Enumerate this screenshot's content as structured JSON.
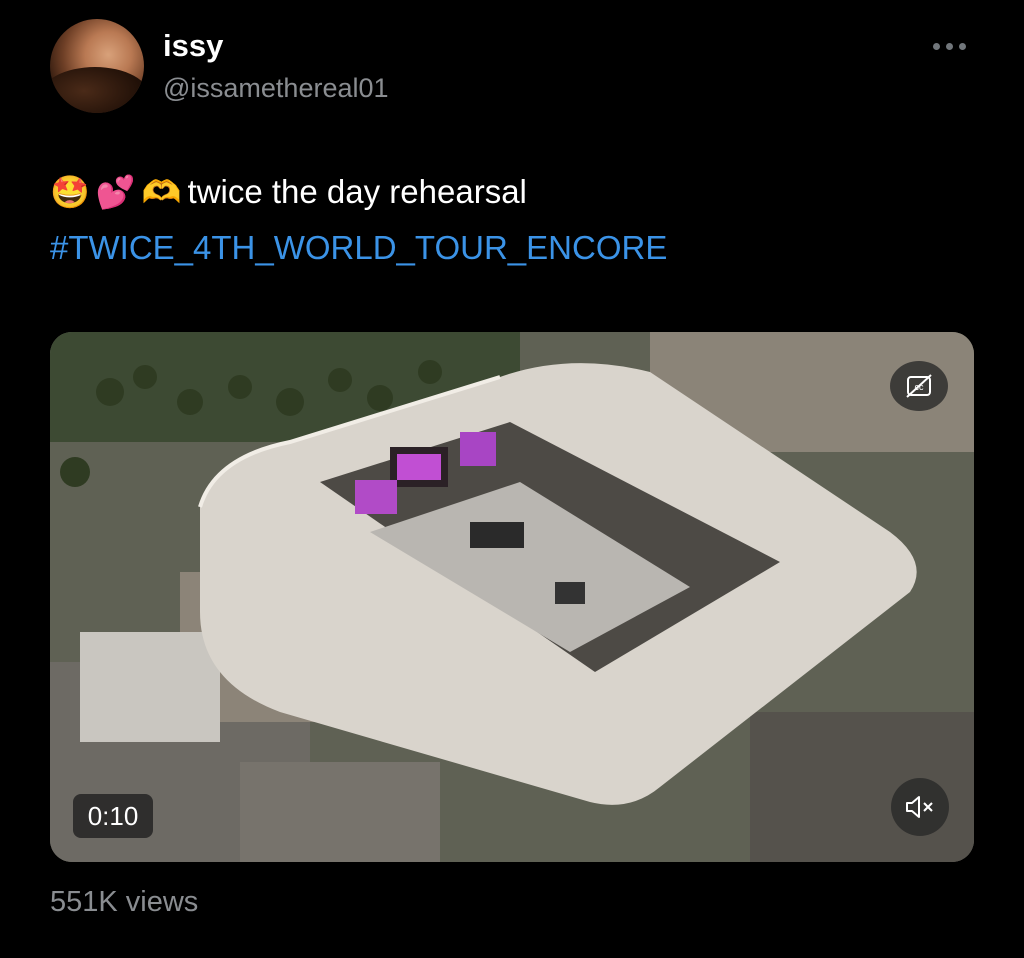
{
  "user": {
    "display_name": "issy",
    "handle": "@issamethereal01"
  },
  "tweet": {
    "emoji_1": "🤩",
    "emoji_2": "💕",
    "emoji_3": "🫶",
    "text": "twice the day rehearsal",
    "hashtag": "#TWICE_4TH_WORLD_TOUR_ENCORE"
  },
  "video": {
    "duration": "0:10",
    "captions_icon": "cc-icon",
    "mute_icon": "speaker-muted-icon"
  },
  "stats": {
    "views": "551K views"
  },
  "colors": {
    "background": "#000000",
    "link": "#3b93e7",
    "secondary_text": "#8a8d91"
  }
}
